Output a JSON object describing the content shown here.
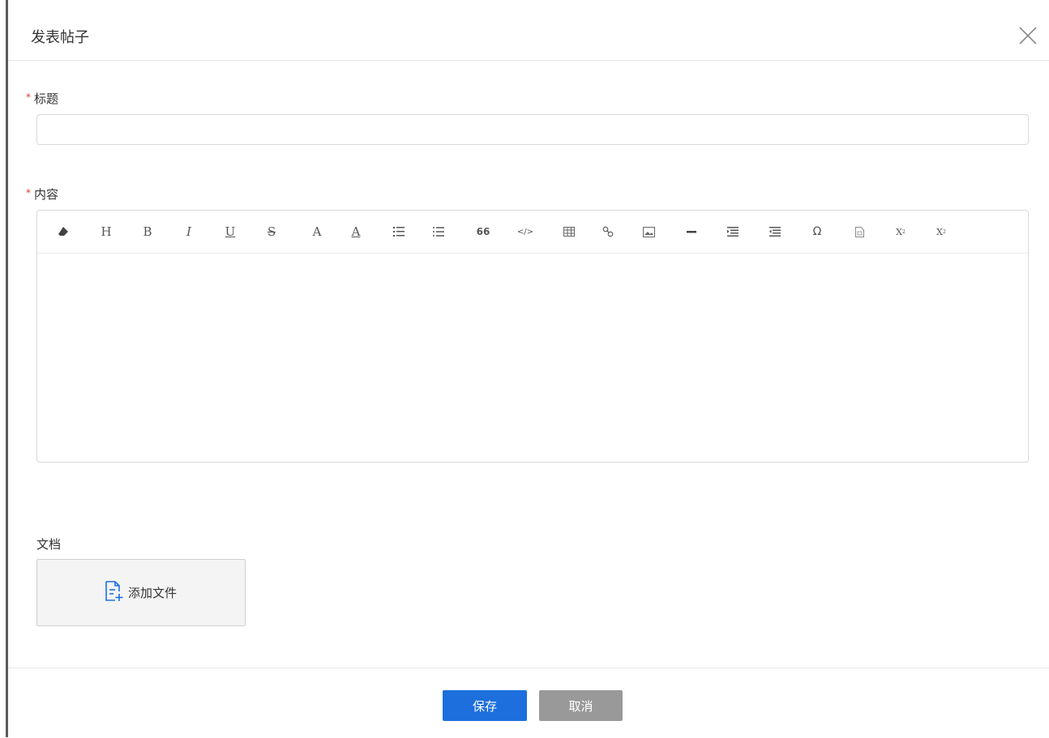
{
  "dialog": {
    "title": "发表帖子"
  },
  "form": {
    "title_label": "标题",
    "title_required_mark": "*",
    "title_value": "",
    "content_label": "内容",
    "content_required_mark": "*",
    "document_label": "文档",
    "add_file_label": "添加文件"
  },
  "toolbar": {
    "items": [
      {
        "name": "eraser-icon",
        "glyph": ""
      },
      {
        "name": "heading-icon",
        "glyph": "H"
      },
      {
        "name": "bold-icon",
        "glyph": "B"
      },
      {
        "name": "italic-icon",
        "glyph": "I"
      },
      {
        "name": "underline-icon",
        "glyph": "U"
      },
      {
        "name": "strikethrough-icon",
        "glyph": "S"
      },
      {
        "name": "font-color-icon",
        "glyph": "A"
      },
      {
        "name": "background-color-icon",
        "glyph": "A"
      },
      {
        "name": "ordered-list-icon",
        "glyph": ""
      },
      {
        "name": "unordered-list-icon",
        "glyph": ""
      },
      {
        "name": "quote-icon",
        "glyph": "66"
      },
      {
        "name": "code-icon",
        "glyph": "</>"
      },
      {
        "name": "table-icon",
        "glyph": ""
      },
      {
        "name": "link-icon",
        "glyph": ""
      },
      {
        "name": "image-icon",
        "glyph": ""
      },
      {
        "name": "horizontal-rule-icon",
        "glyph": ""
      },
      {
        "name": "indent-icon",
        "glyph": ""
      },
      {
        "name": "outdent-icon",
        "glyph": ""
      },
      {
        "name": "special-char-icon",
        "glyph": "Ω"
      },
      {
        "name": "file-icon",
        "glyph": ""
      },
      {
        "name": "superscript-icon",
        "glyph": "X"
      },
      {
        "name": "subscript-icon",
        "glyph": "X"
      }
    ]
  },
  "footer": {
    "save_label": "保存",
    "cancel_label": "取消"
  },
  "colors": {
    "primary": "#1c6fdc",
    "cancel": "#999999",
    "required": "#e03c31"
  }
}
